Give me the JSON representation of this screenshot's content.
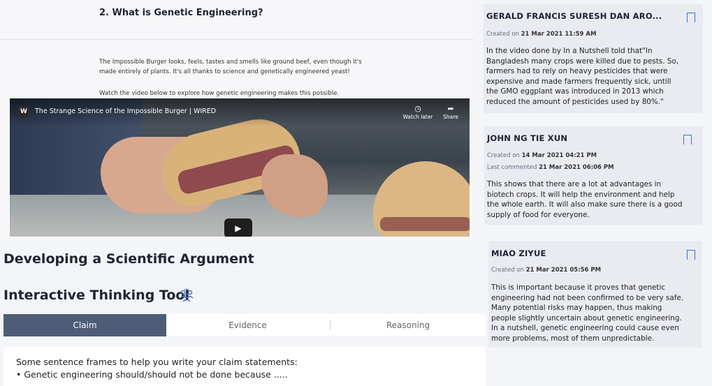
{
  "lesson": {
    "heading": "2. What is Genetic Engineering?",
    "paragraph_1_line_1": "The Impossible Burger looks, feels, tastes and smells like ground beef, even though it's",
    "paragraph_1_line_2": "made entirely of plants. It's all thanks to science and genetically engineered yeast!",
    "paragraph_2": "Watch the video below to explore how genetic engineering makes this possible.",
    "video": {
      "logo": "W",
      "title": "The Strange Science of the Impossible Burger | WIRED",
      "watch_later_label": "Watch later",
      "share_label": "Share",
      "watch_later_icon": "clock-icon",
      "share_icon": "share-arrow-icon",
      "play_icon": "play-icon"
    }
  },
  "argument": {
    "heading": "Developing a Scientific Argument",
    "tool_heading": "Interactive Thinking Tool",
    "tool_icon": "thinking-people-icon",
    "tabs": [
      {
        "label": "Claim",
        "active": true
      },
      {
        "label": "Evidence",
        "active": false
      },
      {
        "label": "Reasoning",
        "active": false
      }
    ],
    "claim_intro": "Some sentence frames to help you write your claim statements:",
    "claim_frame_1": "• Genetic engineering should/should not be done because ....."
  },
  "comments": [
    {
      "author": "GERALD FRANCIS SURESH DAN ARO...",
      "created_label": "Created on",
      "created": "21 Mar 2021 11:59 AM",
      "body": [
        "In the video done by In a Nutshell told that\"In",
        "Bangladesh many crops were killed due to pests. So,",
        "farmers had to rely on heavy pesticides that were",
        "expensive and made farmers frequently sick, untill",
        "the GMO eggplant was introduced in 2013 which",
        "reduced the amount of pesticides used by 80%.\""
      ]
    },
    {
      "author": "JOHN NG TIE XUN",
      "created_label": "Created on",
      "created": "14 Mar 2021 04:21 PM",
      "commented_label": "Last commented",
      "commented": "21 Mar 2021 06:06 PM",
      "body": [
        "This shows that there are a lot at advantages in",
        "biotech crops. It will help the environment and help",
        "the whole earth. It will also make sure there is a good",
        "supply of food for everyone."
      ]
    },
    {
      "author": "MIAO ZIYUE",
      "created_label": "Created on",
      "created": "21 Mar 2021 05:56 PM",
      "body": [
        "This is important because it proves that genetic",
        "engineering had not been confirmed to be very safe.",
        "Many potential risks may happen, thus making",
        "people slightly uncertain about genetic engineering.",
        "In a nutshell, genetic engineering could cause even",
        "more problems, most of them unpredictable."
      ]
    }
  ],
  "colors": {
    "accent": "#3f6fd1",
    "active_tab": "#4d5d78",
    "card_bg": "#e9ebf1"
  }
}
